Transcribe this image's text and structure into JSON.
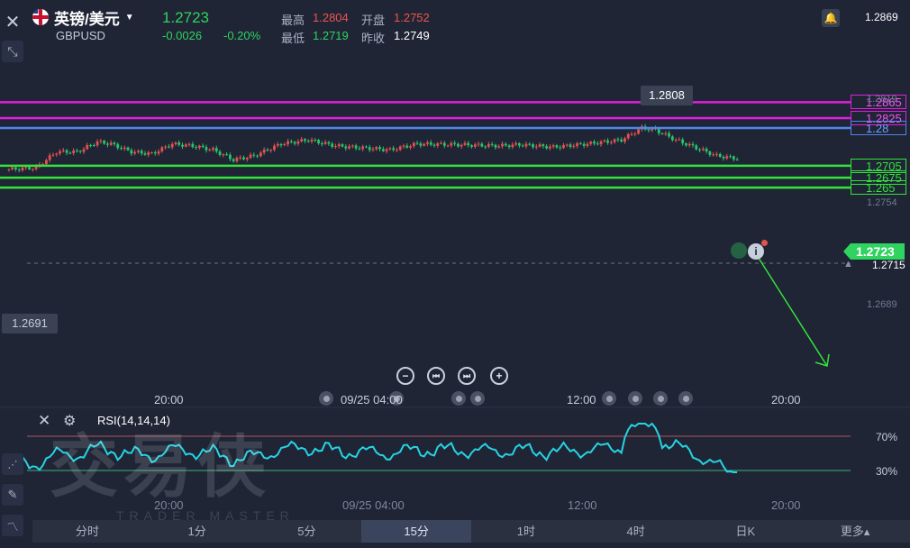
{
  "header": {
    "pair_name": "英镑/美元",
    "symbol": "GBPUSD",
    "last_price": "1.2723",
    "change": "-0.0026",
    "change_pct": "-0.20%",
    "high_label": "最高",
    "high_value": "1.2804",
    "open_label": "开盘",
    "open_value": "1.2752",
    "low_label": "最低",
    "low_value": "1.2719",
    "prev_close_label": "昨收",
    "prev_close_value": "1.2749",
    "top_right_value": "1.2869"
  },
  "levels": [
    {
      "label": "1.2865",
      "value": 1.2865,
      "color": "#e01ee0"
    },
    {
      "label": "1.2825",
      "value": 1.2825,
      "color": "#e01ee0"
    },
    {
      "label": "1.28",
      "value": 1.28,
      "color": "#4f86e6"
    },
    {
      "label": "1.2705",
      "value": 1.2705,
      "color": "#34e23c"
    },
    {
      "label": "1.2675",
      "value": 1.2675,
      "color": "#34e23c"
    },
    {
      "label": "1.265",
      "value": 1.265,
      "color": "#34e23c"
    }
  ],
  "price_axis": {
    "ticks": [
      "1.2819",
      "1.2754",
      "1.2689"
    ],
    "current_price_tag": "1.2723",
    "dashed_level_value": "1.2715"
  },
  "annotations": {
    "high_marker": "1.2808",
    "low_marker": "1.2691"
  },
  "time_axis": [
    "20:00",
    "09/25 04:00",
    "12:00",
    "20:00"
  ],
  "rsi": {
    "label": "RSI(14,14,14)",
    "upper_band": "70%",
    "lower_band": "30%"
  },
  "watermark": {
    "main": "交易侠",
    "sub": "TRADER MASTER"
  },
  "timeframes": [
    {
      "label": "分时",
      "active": false
    },
    {
      "label": "1分",
      "active": false
    },
    {
      "label": "5分",
      "active": false
    },
    {
      "label": "15分",
      "active": true
    },
    {
      "label": "1时",
      "active": false
    },
    {
      "label": "4时",
      "active": false
    },
    {
      "label": "日K",
      "active": false
    },
    {
      "label": "更多▴",
      "active": false
    }
  ],
  "colors": {
    "up": "#e4524f",
    "down": "#29c46a",
    "rsi_line": "#27d3e3",
    "background": "#1f2535"
  },
  "icons": {
    "close": "close-icon",
    "collapse": "collapse-arrows-icon",
    "bell": "bell-icon",
    "info": "info-icon",
    "zoom_out": "minus-icon",
    "jump_start": "skip-start-icon",
    "jump_end": "skip-end-icon",
    "zoom_in": "plus-icon",
    "settings": "gear-icon",
    "pencil": "pencil-icon",
    "indicator": "indicator-icon"
  }
}
